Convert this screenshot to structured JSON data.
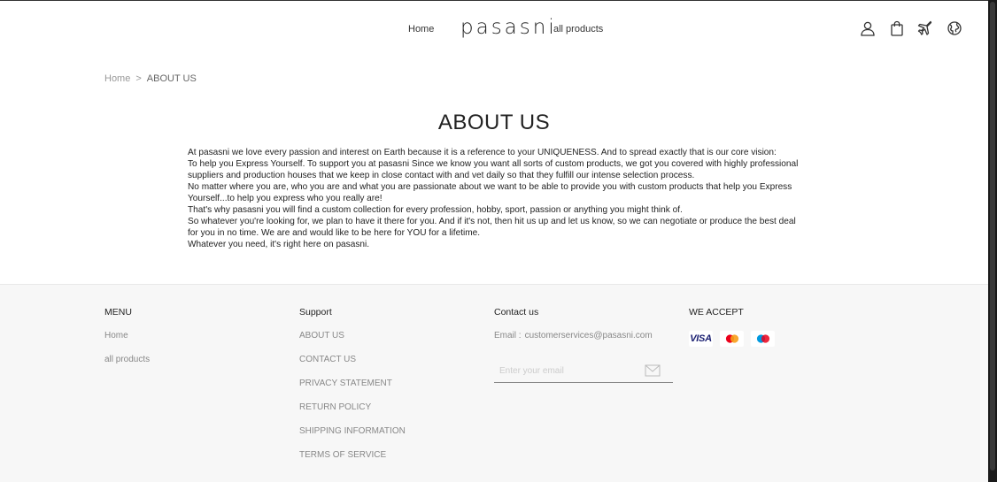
{
  "header": {
    "nav_home": "Home",
    "logo": "pasasni",
    "nav_all_products": "all products",
    "icons": [
      "user-icon",
      "shopping-bag-icon",
      "plane-icon",
      "globe-icon"
    ]
  },
  "breadcrumb": {
    "home": "Home",
    "separator": ">",
    "current": "ABOUT US"
  },
  "main": {
    "title": "ABOUT US",
    "paragraphs": [
      "At pasasni we love every passion and interest on Earth because it is a reference to your UNIQUENESS. And to spread exactly that is our core vision:",
      "To help you Express Yourself. To support you at pasasni Since we know you want all sorts of custom products, we got you covered with highly professional suppliers and production houses that we keep in close contact with and vet daily so that they fulfill our intense selection process.",
      "No matter where you are, who you are and what you are passionate about we want to be able to provide you with custom products that help you Express Yourself...to help you express who you really are!",
      "That's why pasasni you will find a custom collection for every profession, hobby, sport, passion or anything you might think of.",
      "So whatever you're looking for, we plan to have it there for you. And if it's not, then hit us up and let us know, so we can negotiate or produce the best deal for you in no time. We are and would like to be here for YOU for a lifetime.",
      "Whatever you need, it's right here on pasasni."
    ]
  },
  "footer": {
    "menu": {
      "heading": "MENU",
      "links": [
        "Home",
        "all products"
      ]
    },
    "support": {
      "heading": "Support",
      "links": [
        "ABOUT US",
        "CONTACT US",
        "PRIVACY STATEMENT",
        "RETURN POLICY",
        "SHIPPING INFORMATION",
        "TERMS OF SERVICE"
      ]
    },
    "contact": {
      "heading": "Contact us",
      "email_label": "Email :",
      "email_value": "customerservices@pasasni.com",
      "subscribe_placeholder": "Enter your email"
    },
    "accept": {
      "heading": "WE ACCEPT",
      "visa_label": "VISA",
      "cards": [
        "visa-icon",
        "mastercard-icon",
        "maestro-icon"
      ]
    }
  },
  "colors": {
    "text": "#222222",
    "muted": "#888888",
    "footer_bg": "#f7f7f7",
    "visa": "#1a1f71",
    "mc_red": "#eb001b",
    "mc_orange": "#f79e1b",
    "maestro_blue": "#0099df"
  }
}
